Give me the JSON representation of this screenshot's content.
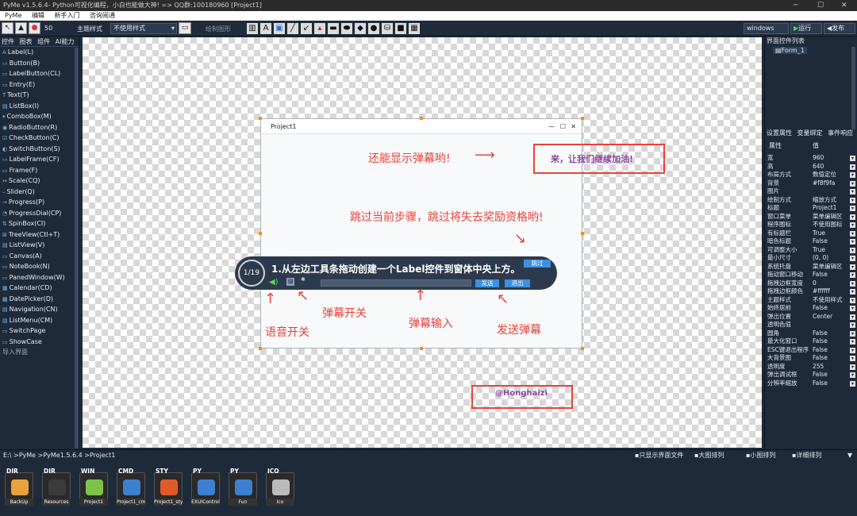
{
  "window": {
    "title": "PyMe v1.5.6.4- Python可视化编程，小白也能做大神!  => QQ群:100180960   [Project1]",
    "minimize": "─",
    "maximize": "☐",
    "close": "✕"
  },
  "menu": [
    "PyMe",
    "编辑",
    "新手入门",
    "咨询阅通"
  ],
  "toolbar": {
    "zoom": "50",
    "theme_label": "主题样式",
    "theme_value": "不使用样式",
    "draw_label": "绘制图形",
    "platform": "windows",
    "run": "运行",
    "publish": "发布"
  },
  "left": {
    "tabs": [
      "控件",
      "图表",
      "组件",
      "AI能力"
    ],
    "items": [
      "Label(L)",
      "Button(B)",
      "LabelButton(CL)",
      "Entry(E)",
      "Text(T)",
      "ListBox(I)",
      "ComboBox(M)",
      "RadioButton(R)",
      "CheckButton(C)",
      "SwitchButton(S)",
      "LabelFrame(CF)",
      "Frame(F)",
      "Scale(CQ)",
      "Slider(Q)",
      "Progress(P)",
      "ProgressDial(CP)",
      "SpinBox(CI)",
      "TreeView(Ctl+T)",
      "ListView(V)",
      "Canvas(A)",
      "NoteBook(N)",
      "PanedWindow(W)",
      "Calendar(CD)",
      "DatePicker(D)",
      "Navigation(CN)",
      "ListMenu(CM)",
      "SwitchPage",
      "ShowCase"
    ],
    "import": "导入界面"
  },
  "form": {
    "title": "Project1"
  },
  "guide": {
    "step": "1/19",
    "message": "1.从左边工具条拖动创建一个Label控件到窗体中央上方。",
    "skip": "跳过",
    "send": "发送",
    "exit": "退出"
  },
  "annotations": {
    "danmu_show": "还能显示弹幕哟!",
    "danmu_sample": "来，让我们继续加油!",
    "skip_hint": "跳过当前步骤，跳过将失去奖励资格哟!",
    "voice": "语音开关",
    "danmu_toggle": "弹幕开关",
    "danmu_input": "弹幕输入",
    "send_danmu": "发送弹幕",
    "watermark": "@Honghaizi"
  },
  "right": {
    "title": "界面控件列表",
    "tree_item": "Form_1",
    "tabs": [
      "设置属性",
      "变量绑定",
      "事件响应"
    ],
    "prop_header": [
      "属性",
      "值"
    ],
    "props": [
      [
        "宽",
        "960"
      ],
      [
        "高",
        "640"
      ],
      [
        "布局方式",
        "数值定位"
      ],
      [
        "背景",
        "#f8f9fa"
      ],
      [
        "图片",
        ""
      ],
      [
        "绘制方式",
        "缩放方式"
      ],
      [
        "标题",
        "Project1"
      ],
      [
        "窗口菜单",
        "菜单编辑区"
      ],
      [
        "程序图标",
        "不使用图标"
      ],
      [
        "有标题栏",
        "True"
      ],
      [
        "暗色标题",
        "False"
      ],
      [
        "可调整大小",
        "True"
      ],
      [
        "最小尺寸",
        "(0, 0)"
      ],
      [
        "系统托盘",
        "菜单编辑区"
      ],
      [
        "拖动窗口移动",
        "False"
      ],
      [
        "拖拽边框宽度",
        "0"
      ],
      [
        "拖拽边框颜色",
        "#ffffff"
      ],
      [
        "主题样式",
        "不使用样式"
      ],
      [
        "始终居前",
        "False"
      ],
      [
        "弹出位置",
        "Center"
      ],
      [
        "透明色值",
        ""
      ],
      [
        "圆角",
        "False"
      ],
      [
        "最大化窗口",
        "False"
      ],
      [
        "ESC键退出程序",
        "False"
      ],
      [
        "大背景图",
        "False"
      ],
      [
        "透明度",
        "255"
      ],
      [
        "弹出调试框",
        "False"
      ],
      [
        "分辨率缩放",
        "False"
      ]
    ]
  },
  "bottom": {
    "path": "E:\\ >PyMe >PyMe1.5.6.4 >Project1",
    "options": [
      "只显示界面文件",
      "大图排列",
      "小图排列",
      "详细排列"
    ],
    "files": [
      {
        "tag": "DIR",
        "name": "BackUp"
      },
      {
        "tag": "DIR",
        "name": "Resources"
      },
      {
        "tag": "WIN",
        "name": "Project1"
      },
      {
        "tag": "CMD",
        "name": "Project1_cmd"
      },
      {
        "tag": "STY",
        "name": "Project1_sty"
      },
      {
        "tag": "PY",
        "name": "EXUIControl"
      },
      {
        "tag": "PY",
        "name": "Fun"
      },
      {
        "tag": "ICO",
        "name": "Ico"
      }
    ]
  },
  "colors": {
    "accent": "#3d8fe0",
    "annotation": "#e8423b",
    "panel": "#1e2a3a"
  }
}
